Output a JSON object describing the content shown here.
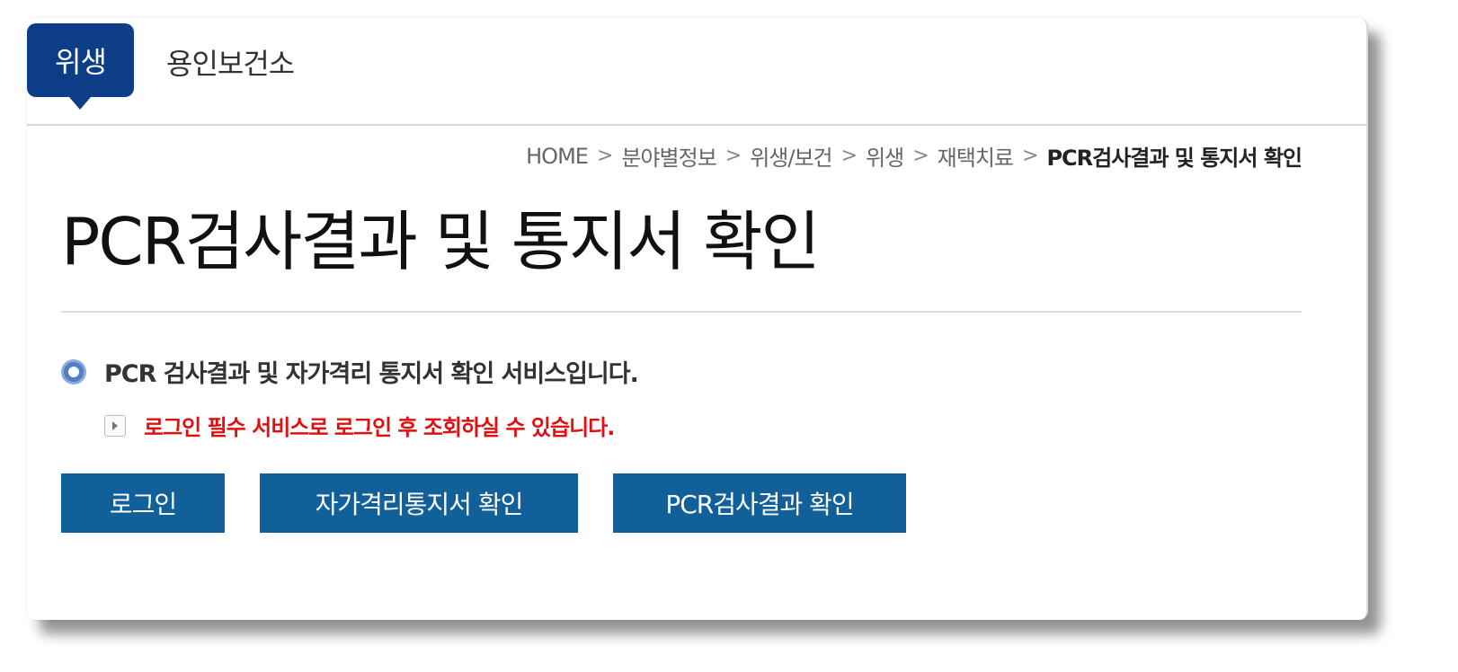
{
  "header": {
    "category_tab": "위생",
    "org_name": "용인보건소"
  },
  "breadcrumb": {
    "items": [
      "HOME",
      "분야별정보",
      "위생/보건",
      "위생",
      "재택치료"
    ],
    "current": "PCR검사결과 및 통지서 확인",
    "separator": ">"
  },
  "page": {
    "title": "PCR검사결과 및 통지서 확인"
  },
  "content": {
    "service_description": "PCR 검사결과 및 자가격리 통지서 확인 서비스입니다.",
    "notice": "로그인 필수 서비스로 로그인 후 조회하실 수 있습니다."
  },
  "buttons": {
    "login": "로그인",
    "quarantine_notice": "자가격리통지서 확인",
    "pcr_result": "PCR검사결과 확인"
  },
  "colors": {
    "category_tab_bg": "#0c3d86",
    "button_bg": "#12609a",
    "notice_text": "#e01010"
  },
  "icons": {
    "bullet": "circle-bullet-icon",
    "notice_arrow": "arrow-box-icon",
    "breadcrumb_separator": "chevron-right-icon"
  }
}
